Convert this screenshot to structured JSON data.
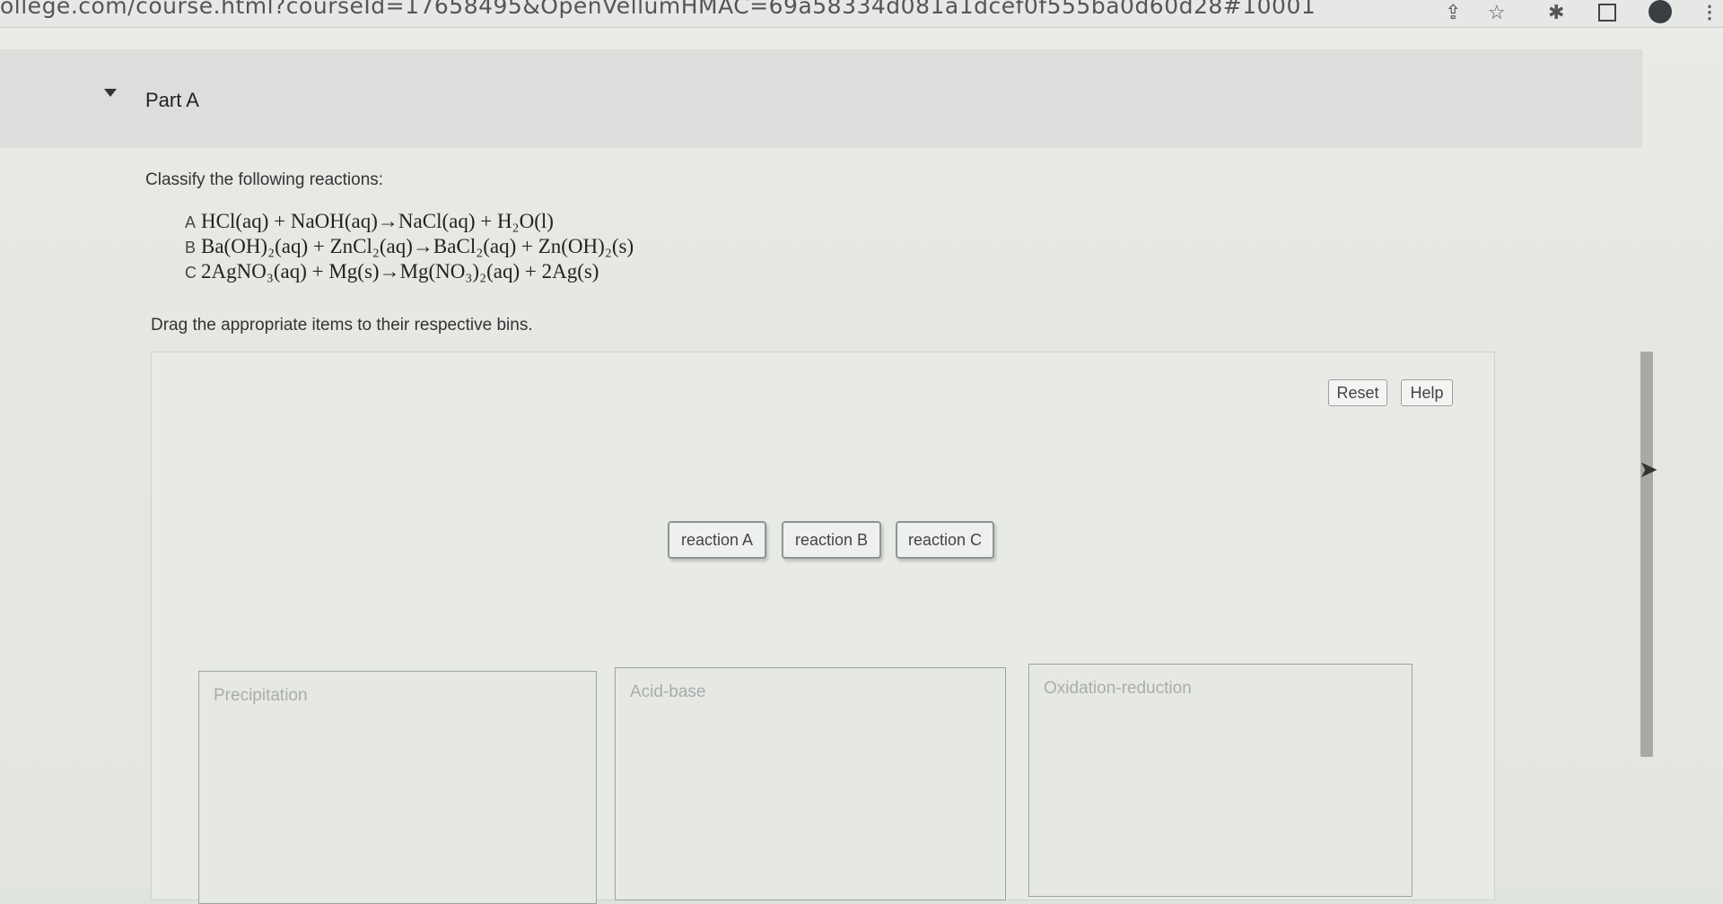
{
  "browser": {
    "url": "ollege.com/course.html?courseId=17658495&OpenVellumHMAC=69a58334d081a1dcef0f555ba0d60d28#10001"
  },
  "part": {
    "title": "Part A"
  },
  "question": "Classify the following reactions:",
  "reactions": [
    {
      "letter": "A",
      "equation": "HCl(aq) + NaOH(aq)→NaCl(aq) + H₂O(l)"
    },
    {
      "letter": "B",
      "equation": "Ba(OH)₂(aq) + ZnCl₂(aq)→BaCl₂(aq) + Zn(OH)₂(s)"
    },
    {
      "letter": "C",
      "equation": "2AgNO₃(aq) + Mg(s)→Mg(NO₃)₂(aq) + 2Ag(s)"
    }
  ],
  "instruction": "Drag the appropriate items to their respective bins.",
  "toolbar": {
    "reset_label": "Reset",
    "help_label": "Help"
  },
  "items": [
    "reaction A",
    "reaction B",
    "reaction C"
  ],
  "bins": [
    "Precipitation",
    "Acid-base",
    "Oxidation-reduction"
  ],
  "icons": {
    "share": "share-icon",
    "star": "bookmark-star-icon",
    "extensions": "puzzle-extension-icon",
    "window": "window-icon",
    "profile": "profile-avatar-icon",
    "menu": "kebab-menu-icon",
    "caret": "caret-down-icon",
    "cursor": "mouse-cursor-icon"
  }
}
